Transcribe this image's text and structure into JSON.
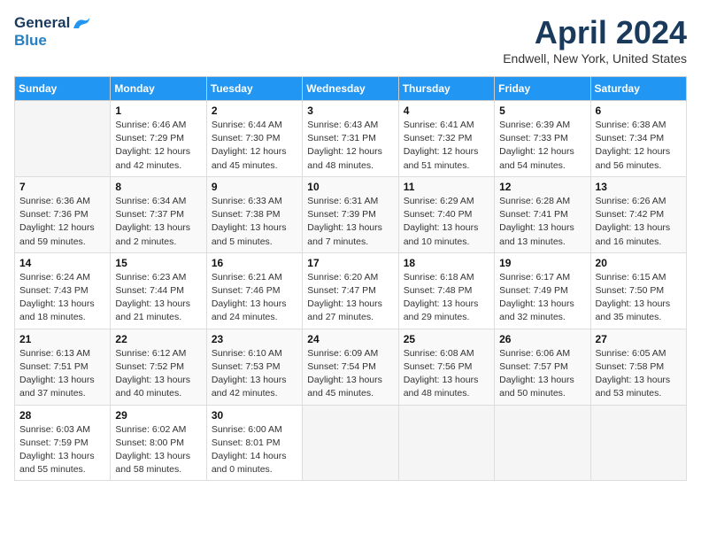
{
  "header": {
    "logo_general": "General",
    "logo_blue": "Blue",
    "title": "April 2024",
    "subtitle": "Endwell, New York, United States"
  },
  "days_of_week": [
    "Sunday",
    "Monday",
    "Tuesday",
    "Wednesday",
    "Thursday",
    "Friday",
    "Saturday"
  ],
  "weeks": [
    [
      {
        "day": "",
        "info": ""
      },
      {
        "day": "1",
        "info": "Sunrise: 6:46 AM\nSunset: 7:29 PM\nDaylight: 12 hours\nand 42 minutes."
      },
      {
        "day": "2",
        "info": "Sunrise: 6:44 AM\nSunset: 7:30 PM\nDaylight: 12 hours\nand 45 minutes."
      },
      {
        "day": "3",
        "info": "Sunrise: 6:43 AM\nSunset: 7:31 PM\nDaylight: 12 hours\nand 48 minutes."
      },
      {
        "day": "4",
        "info": "Sunrise: 6:41 AM\nSunset: 7:32 PM\nDaylight: 12 hours\nand 51 minutes."
      },
      {
        "day": "5",
        "info": "Sunrise: 6:39 AM\nSunset: 7:33 PM\nDaylight: 12 hours\nand 54 minutes."
      },
      {
        "day": "6",
        "info": "Sunrise: 6:38 AM\nSunset: 7:34 PM\nDaylight: 12 hours\nand 56 minutes."
      }
    ],
    [
      {
        "day": "7",
        "info": "Sunrise: 6:36 AM\nSunset: 7:36 PM\nDaylight: 12 hours\nand 59 minutes."
      },
      {
        "day": "8",
        "info": "Sunrise: 6:34 AM\nSunset: 7:37 PM\nDaylight: 13 hours\nand 2 minutes."
      },
      {
        "day": "9",
        "info": "Sunrise: 6:33 AM\nSunset: 7:38 PM\nDaylight: 13 hours\nand 5 minutes."
      },
      {
        "day": "10",
        "info": "Sunrise: 6:31 AM\nSunset: 7:39 PM\nDaylight: 13 hours\nand 7 minutes."
      },
      {
        "day": "11",
        "info": "Sunrise: 6:29 AM\nSunset: 7:40 PM\nDaylight: 13 hours\nand 10 minutes."
      },
      {
        "day": "12",
        "info": "Sunrise: 6:28 AM\nSunset: 7:41 PM\nDaylight: 13 hours\nand 13 minutes."
      },
      {
        "day": "13",
        "info": "Sunrise: 6:26 AM\nSunset: 7:42 PM\nDaylight: 13 hours\nand 16 minutes."
      }
    ],
    [
      {
        "day": "14",
        "info": "Sunrise: 6:24 AM\nSunset: 7:43 PM\nDaylight: 13 hours\nand 18 minutes."
      },
      {
        "day": "15",
        "info": "Sunrise: 6:23 AM\nSunset: 7:44 PM\nDaylight: 13 hours\nand 21 minutes."
      },
      {
        "day": "16",
        "info": "Sunrise: 6:21 AM\nSunset: 7:46 PM\nDaylight: 13 hours\nand 24 minutes."
      },
      {
        "day": "17",
        "info": "Sunrise: 6:20 AM\nSunset: 7:47 PM\nDaylight: 13 hours\nand 27 minutes."
      },
      {
        "day": "18",
        "info": "Sunrise: 6:18 AM\nSunset: 7:48 PM\nDaylight: 13 hours\nand 29 minutes."
      },
      {
        "day": "19",
        "info": "Sunrise: 6:17 AM\nSunset: 7:49 PM\nDaylight: 13 hours\nand 32 minutes."
      },
      {
        "day": "20",
        "info": "Sunrise: 6:15 AM\nSunset: 7:50 PM\nDaylight: 13 hours\nand 35 minutes."
      }
    ],
    [
      {
        "day": "21",
        "info": "Sunrise: 6:13 AM\nSunset: 7:51 PM\nDaylight: 13 hours\nand 37 minutes."
      },
      {
        "day": "22",
        "info": "Sunrise: 6:12 AM\nSunset: 7:52 PM\nDaylight: 13 hours\nand 40 minutes."
      },
      {
        "day": "23",
        "info": "Sunrise: 6:10 AM\nSunset: 7:53 PM\nDaylight: 13 hours\nand 42 minutes."
      },
      {
        "day": "24",
        "info": "Sunrise: 6:09 AM\nSunset: 7:54 PM\nDaylight: 13 hours\nand 45 minutes."
      },
      {
        "day": "25",
        "info": "Sunrise: 6:08 AM\nSunset: 7:56 PM\nDaylight: 13 hours\nand 48 minutes."
      },
      {
        "day": "26",
        "info": "Sunrise: 6:06 AM\nSunset: 7:57 PM\nDaylight: 13 hours\nand 50 minutes."
      },
      {
        "day": "27",
        "info": "Sunrise: 6:05 AM\nSunset: 7:58 PM\nDaylight: 13 hours\nand 53 minutes."
      }
    ],
    [
      {
        "day": "28",
        "info": "Sunrise: 6:03 AM\nSunset: 7:59 PM\nDaylight: 13 hours\nand 55 minutes."
      },
      {
        "day": "29",
        "info": "Sunrise: 6:02 AM\nSunset: 8:00 PM\nDaylight: 13 hours\nand 58 minutes."
      },
      {
        "day": "30",
        "info": "Sunrise: 6:00 AM\nSunset: 8:01 PM\nDaylight: 14 hours\nand 0 minutes."
      },
      {
        "day": "",
        "info": ""
      },
      {
        "day": "",
        "info": ""
      },
      {
        "day": "",
        "info": ""
      },
      {
        "day": "",
        "info": ""
      }
    ]
  ]
}
